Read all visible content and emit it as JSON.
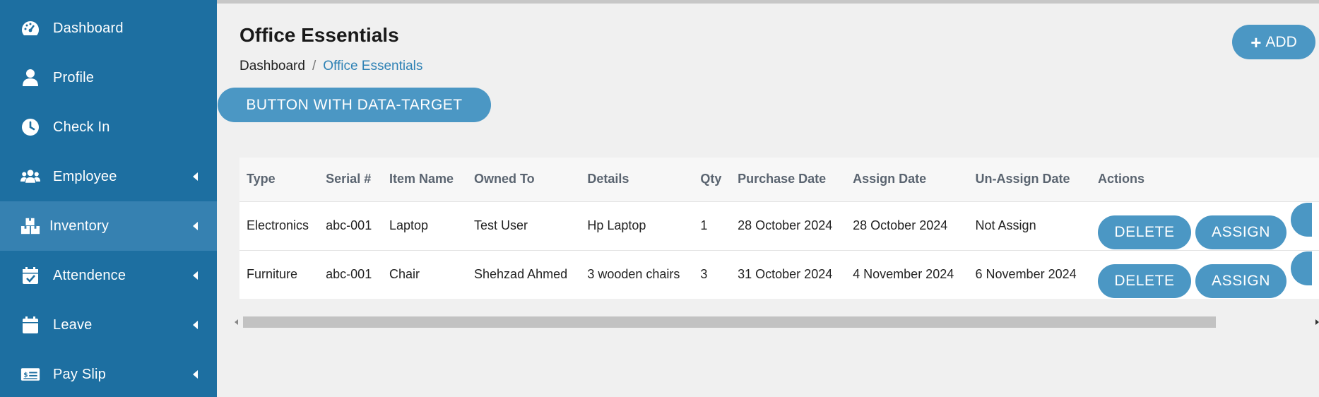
{
  "sidebar": {
    "items": [
      {
        "label": "Dashboard",
        "icon": "speedometer-icon",
        "has_caret": false
      },
      {
        "label": "Profile",
        "icon": "user-icon",
        "has_caret": false
      },
      {
        "label": "Check In",
        "icon": "clock-icon",
        "has_caret": false
      },
      {
        "label": "Employee",
        "icon": "users-icon",
        "has_caret": true
      },
      {
        "label": "Inventory",
        "icon": "boxes-icon",
        "has_caret": true,
        "active": true
      },
      {
        "label": "Attendence",
        "icon": "calendar-check-icon",
        "has_caret": true
      },
      {
        "label": "Leave",
        "icon": "calendar-icon",
        "has_caret": true
      },
      {
        "label": "Pay Slip",
        "icon": "money-check-icon",
        "has_caret": true
      }
    ]
  },
  "header": {
    "title": "Office Essentials",
    "breadcrumb": {
      "home": "Dashboard",
      "separator": "/",
      "current": "Office Essentials"
    },
    "add_label": "ADD"
  },
  "data_target_button": "BUTTON WITH DATA-TARGET",
  "table": {
    "columns": [
      "Type",
      "Serial #",
      "Item Name",
      "Owned To",
      "Details",
      "Qty",
      "Purchase Date",
      "Assign Date",
      "Un-Assign Date",
      "Actions"
    ],
    "rows": [
      {
        "type": "Electronics",
        "serial": "abc-001",
        "item_name": "Laptop",
        "owned_to": "Test User",
        "details": "Hp Laptop",
        "qty": "1",
        "purchase_date": "28 October 2024",
        "assign_date": "28 October 2024",
        "unassign_date": "Not Assign"
      },
      {
        "type": "Furniture",
        "serial": "abc-001",
        "item_name": "Chair",
        "owned_to": "Shehzad Ahmed",
        "details": "3 wooden chairs",
        "qty": "3",
        "purchase_date": "31 October 2024",
        "assign_date": "4 November 2024",
        "unassign_date": "6 November 2024"
      }
    ],
    "actions": {
      "delete_label": "DELETE",
      "assign_label": "ASSIGN"
    }
  },
  "colors": {
    "sidebar_bg": "#1d6fa1",
    "sidebar_active_bg": "#3681b1",
    "button_bg": "#4b97c4",
    "breadcrumb_link": "#2f82b5",
    "page_bg": "#f0f0f0"
  }
}
